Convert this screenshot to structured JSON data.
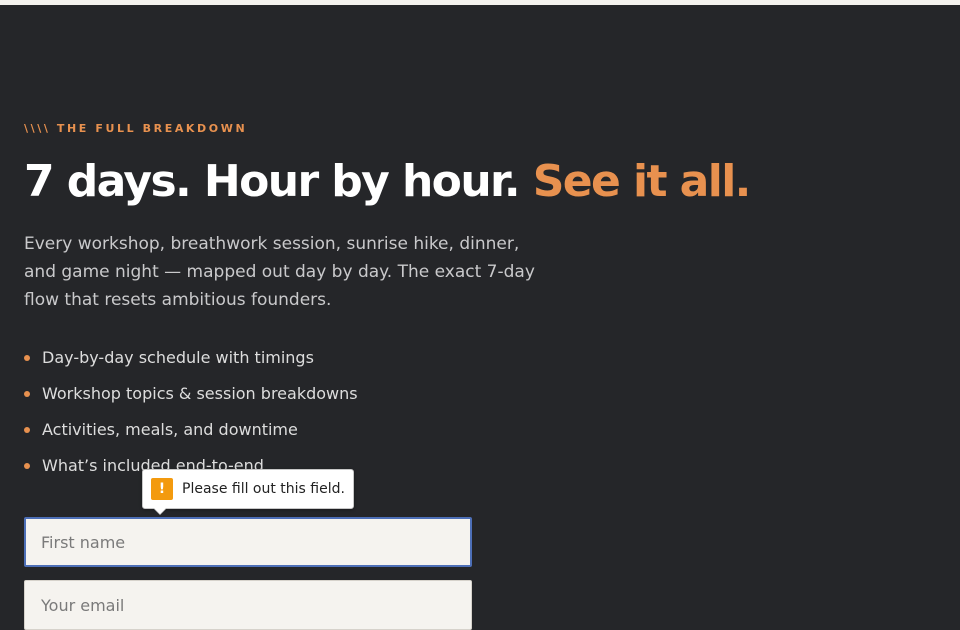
{
  "hero": {
    "eyebrow": "\\\\\\\\ THE FULL BREAKDOWN",
    "title_main": "7 days. Hour by hour. ",
    "title_accent": "See it all.",
    "lede": "Every workshop, breathwork session, sunrise hike, dinner, and game night — mapped out day by day. The exact 7-day flow that resets ambitious founders.",
    "bullets": [
      "Day-by-day schedule with timings",
      "Workshop topics & session breakdowns",
      "Activities, meals, and downtime",
      "What’s included end-to-end"
    ]
  },
  "form": {
    "first_name_placeholder": "First name",
    "email_placeholder": "Your email"
  },
  "validation": {
    "icon": "warning-icon",
    "message": "Please fill out this field."
  },
  "colors": {
    "background": "#252629",
    "accent": "#e8914f",
    "focus_ring": "#4d6fb7",
    "warning": "#f39a0e"
  }
}
